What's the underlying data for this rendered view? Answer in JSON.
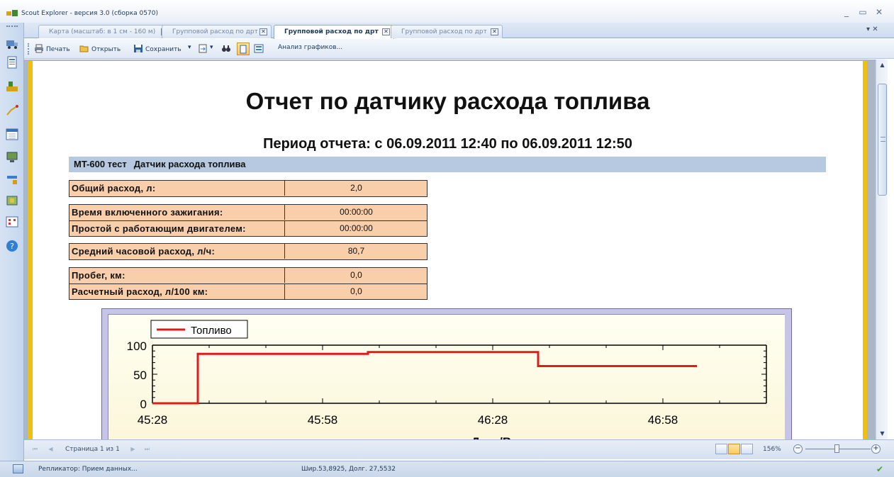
{
  "window": {
    "title": "Scout Explorer - версия 3.0 (сборка 0570)",
    "minimize_glyph": "_",
    "restore_glyph": "▭",
    "close_glyph": "✕"
  },
  "tabs": [
    {
      "label": "Карта (масштаб: в 1 см - 160 м)",
      "active": false
    },
    {
      "label": "Групповой расход по дрт",
      "active": false
    },
    {
      "label": "Групповой расход по дрт",
      "active": true
    },
    {
      "label": "Групповой расход по дрт",
      "active": false
    }
  ],
  "tab_close_glyph": "✕",
  "tab_menu_glyph": "▾ ✕",
  "toolbar": {
    "print_label": "Печать",
    "open_label": "Открыть",
    "save_label": "Сохранить",
    "dropdown_glyph": "▾",
    "find_glyph": "🔍",
    "analysis_label": "Анализ графиков..."
  },
  "report": {
    "title": "Отчет по датчику расхода топлива",
    "period": "Период отчета: с 06.09.2011 12:40 по 06.09.2011 12:50",
    "object_name": "MT-600 тест",
    "sensor_name": "Датчик расхода топлива",
    "groups": [
      [
        {
          "label": "Общий расход, л:",
          "value": "2,0"
        }
      ],
      [
        {
          "label": "Время включенного зажигания:",
          "value": "00:00:00"
        },
        {
          "label": "Простой с работающим двигателем:",
          "value": "00:00:00"
        }
      ],
      [
        {
          "label": "Средний часовой расход, л/ч:",
          "value": "80,7"
        }
      ],
      [
        {
          "label": "Пробег, км:",
          "value": "0,0"
        },
        {
          "label": "Расчетный расход, л/100 км:",
          "value": "0,0"
        }
      ]
    ]
  },
  "chart_data": {
    "type": "line",
    "series": [
      {
        "name": "Топливо",
        "color": "#e01b1b",
        "x": [
          "45:28",
          "45:36",
          "45:36",
          "46:06",
          "46:06",
          "46:36",
          "46:36",
          "47:04"
        ],
        "y": [
          0,
          0,
          85,
          85,
          88,
          88,
          64,
          64
        ]
      }
    ],
    "xticks": [
      "45:28",
      "45:58",
      "46:28",
      "46:58"
    ],
    "yticks": [
      0,
      50,
      100
    ],
    "ylim": [
      0,
      100
    ],
    "xlabel": "Дата/Время",
    "legend_position": "top-left",
    "grid": false
  },
  "pager": {
    "page_text": "Страница 1 из 1",
    "first_glyph": "⏮",
    "prev_glyph": "◀",
    "next_glyph": "▶",
    "last_glyph": "⏭",
    "zoom_text": "156%",
    "zoom_minus": "−",
    "zoom_plus": "+"
  },
  "status": {
    "replicator": "Репликатор: Прием данных...",
    "coords": "Шир.53,8925, Долг. 27,5532",
    "ok_glyph": "✔"
  },
  "icons": {
    "left_toolbar": [
      "truck-icon",
      "report-icon",
      "map-objects-icon",
      "track-icon",
      "calendar-icon",
      "monitor-icon",
      "sensor-icon",
      "map-layers-icon",
      "grid-icon",
      "help-icon"
    ]
  }
}
